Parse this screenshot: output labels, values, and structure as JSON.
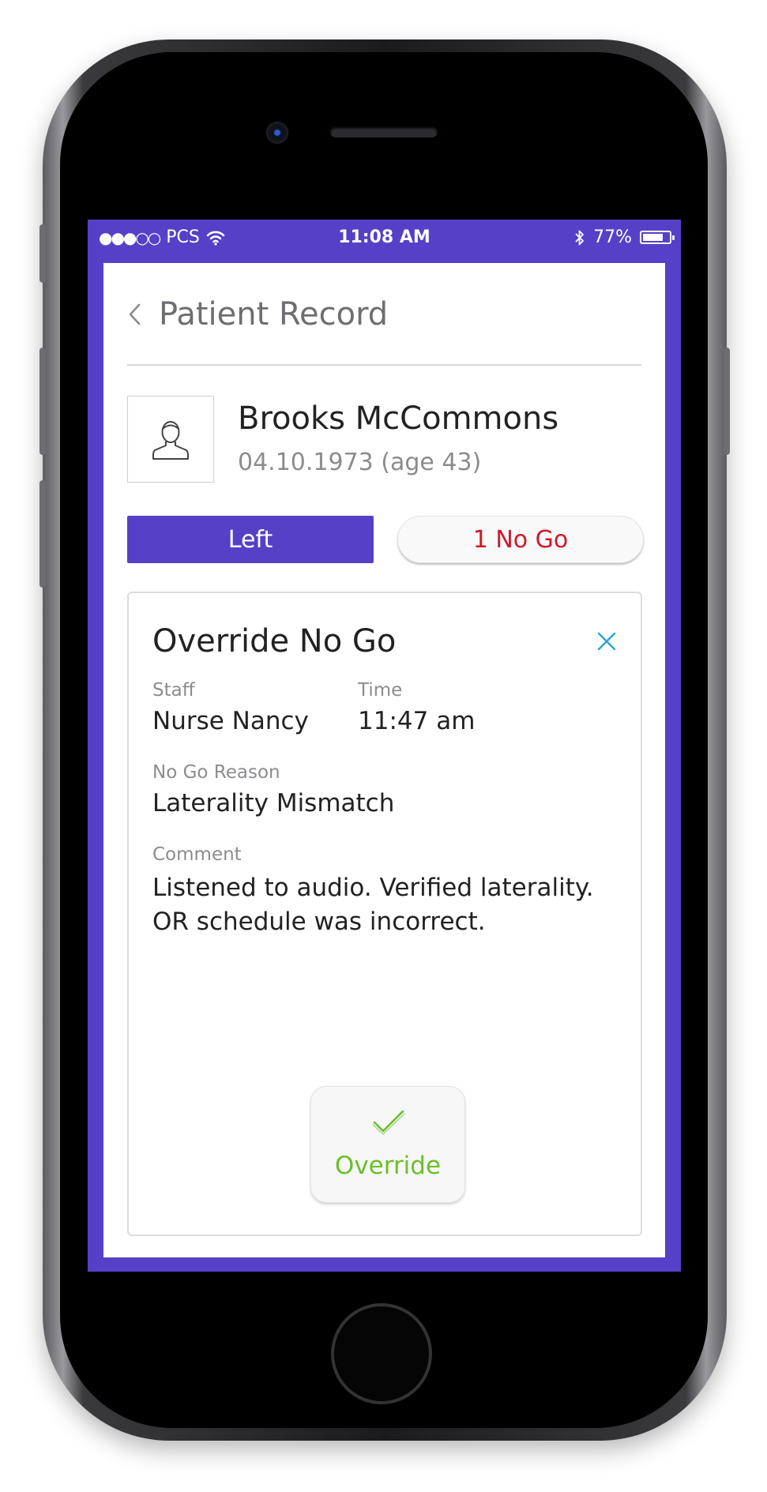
{
  "status_bar": {
    "signal": "●●●○○",
    "carrier": "PCS",
    "time": "11:08 AM",
    "battery": "77%",
    "battery_level": 0.77
  },
  "nav": {
    "back_icon": "chevron-left-icon",
    "title": "Patient Record"
  },
  "patient": {
    "name": "Brooks McCommons",
    "dob": "04.10.1973 (age 43)"
  },
  "actions": {
    "left_label": "Left",
    "nogo_label": "1 No Go"
  },
  "override_panel": {
    "title": "Override No Go",
    "staff_label": "Staff",
    "staff_value": "Nurse Nancy",
    "time_label": "Time",
    "time_value": "11:47 am",
    "reason_label": "No Go Reason",
    "reason_value": "Laterality Mismatch",
    "comment_label": "Comment",
    "comment_value": "Listened to audio. Verified laterality. OR schedule was incorrect.",
    "override_label": "Override"
  },
  "colors": {
    "brand": "#5640c7",
    "danger": "#cc1a2b",
    "success": "#6bbf2a",
    "close": "#2aa6cc"
  }
}
